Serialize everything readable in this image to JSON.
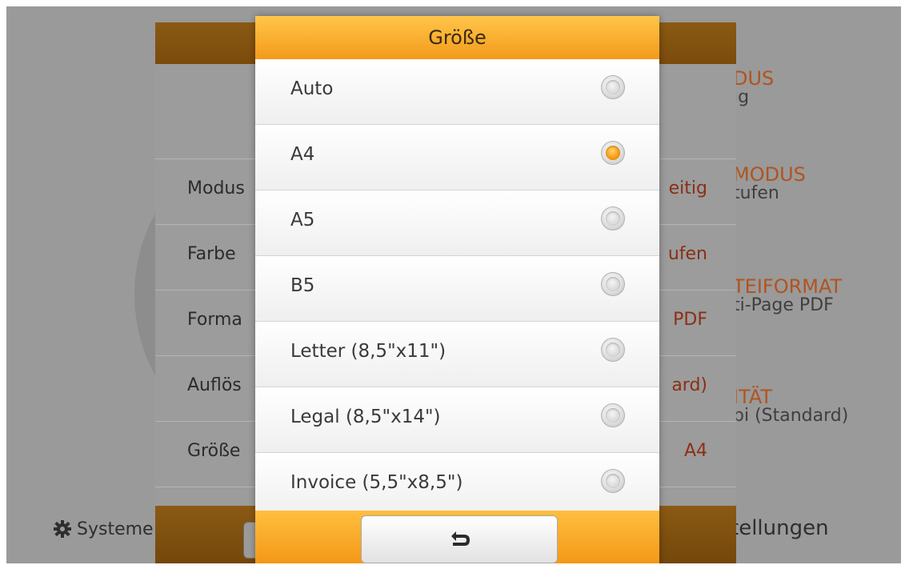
{
  "background": {
    "right_panel": [
      {
        "title": "DUS",
        "subtitle": "ig"
      },
      {
        "title": "MODUS",
        "subtitle": "tufen"
      },
      {
        "title": "TEIFORMAT",
        "subtitle": "ti-Page PDF"
      },
      {
        "title": "ITÄT",
        "subtitle": "pi (Standard)"
      }
    ],
    "bottom_left_label": "Systeme",
    "bottom_right_label": "tellungen"
  },
  "settings_panel": {
    "rows": [
      {
        "label": "Modus",
        "value": "eitig"
      },
      {
        "label": "Farbe",
        "value": "ufen"
      },
      {
        "label": "Forma",
        "value": "PDF"
      },
      {
        "label": "Auflös",
        "value": "ard)"
      },
      {
        "label": "Größe",
        "value": "A4"
      }
    ]
  },
  "dialog": {
    "title": "Größe",
    "selected": "A4",
    "options": [
      {
        "label": "Auto",
        "checked": false
      },
      {
        "label": "A4",
        "checked": true
      },
      {
        "label": "A5",
        "checked": false
      },
      {
        "label": "B5",
        "checked": false
      },
      {
        "label": "Letter (8,5\"x11\")",
        "checked": false
      },
      {
        "label": "Legal (8,5\"x14\")",
        "checked": false
      },
      {
        "label": "Invoice (5,5\"x8,5\")",
        "checked": false
      }
    ],
    "back_icon": "back-arrow-icon"
  },
  "colors": {
    "accent": "#f39a1a",
    "accent_light": "#ffc64a",
    "radio_checked": "#f59a10"
  }
}
